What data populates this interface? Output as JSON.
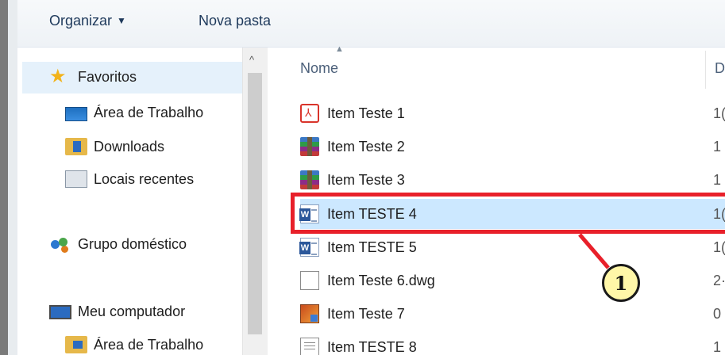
{
  "toolbar": {
    "organize_label": "Organizar",
    "new_folder_label": "Nova pasta"
  },
  "navigation": {
    "favorites": {
      "label": "Favoritos",
      "icon": "star-icon"
    },
    "items": [
      {
        "label": "Área de Trabalho",
        "icon": "desktop-icon"
      },
      {
        "label": "Downloads",
        "icon": "downloads-folder-icon"
      },
      {
        "label": "Locais recentes",
        "icon": "recent-places-icon"
      }
    ],
    "homegroup": {
      "label": "Grupo doméstico",
      "icon": "homegroup-icon"
    },
    "computer": {
      "label": "Meu computador",
      "icon": "computer-icon"
    },
    "computer_items": [
      {
        "label": "Área de Trabalho",
        "icon": "desktop-folder-icon"
      }
    ]
  },
  "file_list": {
    "column_name": "Nome",
    "column_date_partial": "D",
    "rows": [
      {
        "name": "Item Teste 1",
        "icon": "pdf-icon",
        "date_partial": "1("
      },
      {
        "name": "Item Teste 2",
        "icon": "rar-archive-icon",
        "date_partial": "1"
      },
      {
        "name": "Item Teste 3",
        "icon": "rar-archive-icon",
        "date_partial": "1"
      },
      {
        "name": "Item TESTE 4",
        "icon": "word-document-icon",
        "date_partial": "1(",
        "selected": true
      },
      {
        "name": "Item TESTE 5",
        "icon": "word-document-icon",
        "date_partial": "1("
      },
      {
        "name": "Item Teste 6.dwg",
        "icon": "blank-file-icon",
        "date_partial": "2·"
      },
      {
        "name": "Item Teste 7",
        "icon": "image-file-icon",
        "date_partial": "0"
      },
      {
        "name": "Item TESTE 8",
        "icon": "text-file-icon",
        "date_partial": "1"
      }
    ]
  },
  "annotation": {
    "callout_number": "1",
    "highlight_color": "#e8202a",
    "callout_fill": "#fff7a8"
  },
  "colors": {
    "selection": "#cce8ff",
    "nav_hover": "#e5f1fb",
    "toolbar_text": "#1e395b"
  }
}
